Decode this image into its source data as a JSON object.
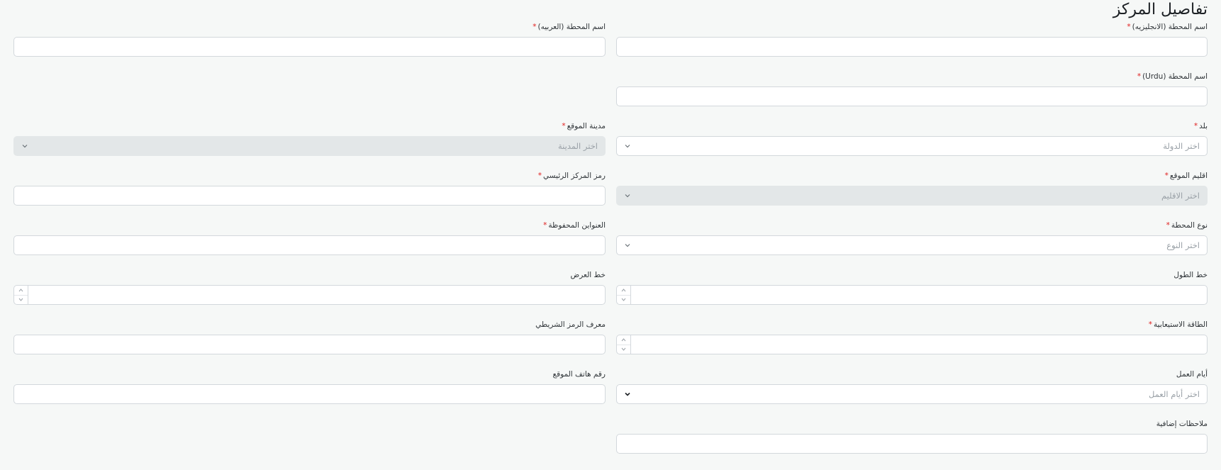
{
  "page_title": "تفاصيل المركز",
  "fields": {
    "station_name_en": {
      "label": "اسم المحطة  (الانجليزيه)",
      "required_mark": "*",
      "value": ""
    },
    "station_name_ar": {
      "label": "اسم المحطة  (العربيه)",
      "required_mark": "*",
      "value": ""
    },
    "station_name_ur": {
      "label": "اسم المحطة  (Urdu)",
      "required_mark": "*",
      "value": ""
    },
    "country": {
      "label": "بلد",
      "required_mark": "*",
      "placeholder": "اختر الدولة"
    },
    "city": {
      "label": "مدينة الموقع",
      "required_mark": "*",
      "placeholder": "اختر المدينة"
    },
    "region": {
      "label": "اقليم الموقع",
      "required_mark": "*",
      "placeholder": "اختر الاقليم"
    },
    "main_center_code": {
      "label": "رمز المركز الرئيسي",
      "required_mark": "*",
      "value": ""
    },
    "station_type": {
      "label": "نوع المحطة",
      "required_mark": "*",
      "placeholder": "اختر النوع"
    },
    "saved_addresses": {
      "label": "العنواين المحفوظة",
      "required_mark": "*",
      "value": ""
    },
    "longitude": {
      "label": "خط الطول",
      "value": ""
    },
    "latitude": {
      "label": "خط العرض",
      "value": ""
    },
    "capacity": {
      "label": "الطاقة الاستيعابية",
      "required_mark": "*",
      "value": ""
    },
    "barcode_id": {
      "label": "معرف الرمز الشريطي",
      "value": ""
    },
    "working_days": {
      "label": "أيام العمل",
      "placeholder": "اختر أيام العمل"
    },
    "site_phone": {
      "label": "رقم هاتف الموقع",
      "value": ""
    },
    "additional_notes": {
      "label": "ملاحظات إضافية",
      "value": ""
    }
  }
}
